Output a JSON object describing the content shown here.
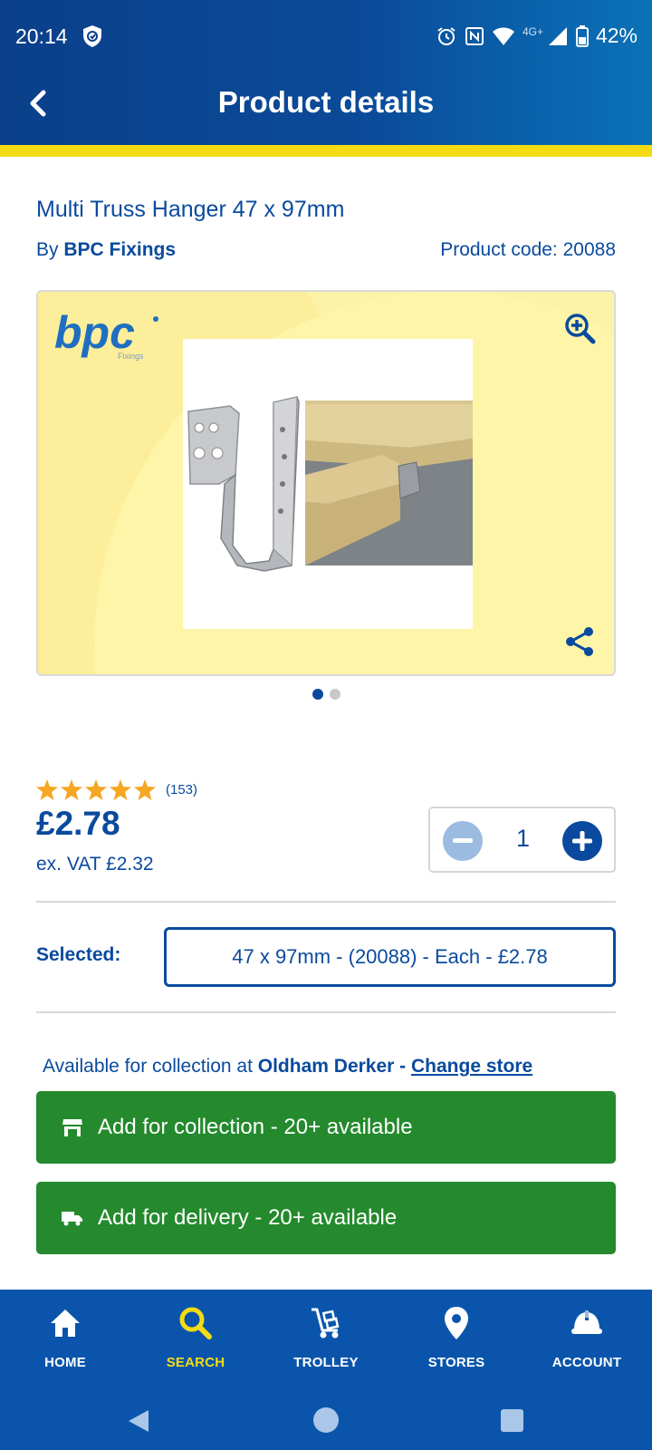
{
  "status_bar": {
    "time": "20:14",
    "battery": "42%",
    "network": "4G+"
  },
  "header": {
    "title": "Product details"
  },
  "product": {
    "name": "Multi Truss Hanger 47 x 97mm",
    "brand_prefix": "By",
    "brand": "BPC Fixings",
    "product_code": "Product code: 20088",
    "logo_text": "bpc",
    "logo_subtext": "Fixings",
    "image_count": 2,
    "active_image": 1
  },
  "rating": {
    "stars": 5,
    "count": "(153)"
  },
  "pricing": {
    "price": "£2.78",
    "ex_vat": "ex. VAT £2.32"
  },
  "quantity": {
    "value": "1"
  },
  "variant": {
    "label": "Selected:",
    "value": "47 x 97mm - (20088) - Each - £2.78"
  },
  "availability": {
    "prefix": "Available for collection at",
    "store": "Oldham Derker -",
    "change_store": "Change store"
  },
  "actions": {
    "collection": "Add for collection - 20+ available",
    "delivery": "Add for delivery - 20+ available"
  },
  "bottom_nav": {
    "items": [
      {
        "label": "HOME",
        "icon": "home-icon"
      },
      {
        "label": "SEARCH",
        "icon": "search-icon",
        "active": true
      },
      {
        "label": "TROLLEY",
        "icon": "trolley-icon"
      },
      {
        "label": "STORES",
        "icon": "location-pin-icon"
      },
      {
        "label": "ACCOUNT",
        "icon": "hard-hat-icon"
      }
    ]
  },
  "colors": {
    "brand_blue": "#0a4a9e",
    "accent_yellow": "#f5dc12",
    "action_green": "#248a2d",
    "star_orange": "#f5a623"
  }
}
